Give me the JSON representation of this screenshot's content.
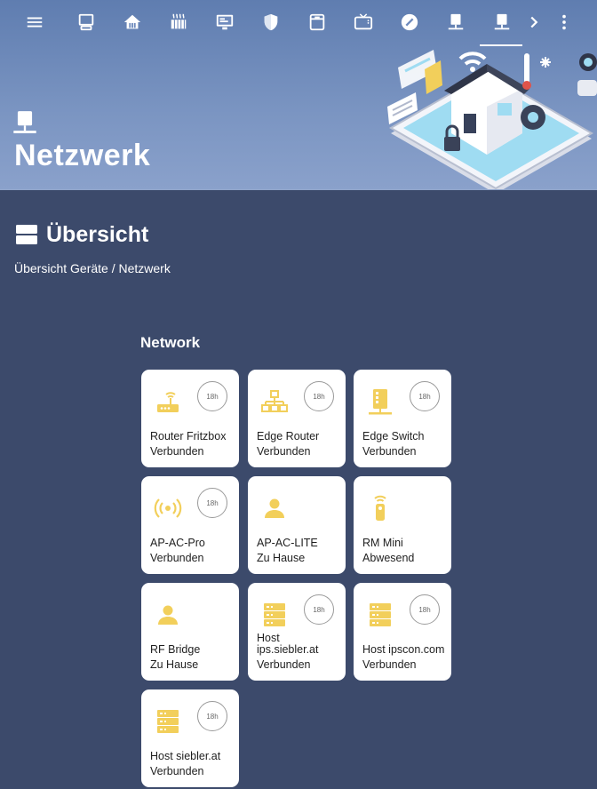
{
  "colors": {
    "background": "#3c4a6b",
    "header": "#6f8bbd",
    "accent": "#f2cf5b",
    "tile": "#ffffff"
  },
  "topbar": {
    "icons": [
      "menu-icon",
      "desktop-icon",
      "home-icon",
      "heater-icon",
      "monitor-icon",
      "shield-icon",
      "box-icon",
      "tv-icon",
      "speedometer-icon",
      "network-icon",
      "network-icon-active",
      "chevron-right-icon",
      "more-vert-icon"
    ]
  },
  "page": {
    "title": "Netzwerk",
    "icon": "network-icon"
  },
  "section": {
    "title": "Übersicht",
    "breadcrumb": "Übersicht Geräte / Netzwerk",
    "icon": "view-agenda-icon"
  },
  "group": {
    "title": "Network"
  },
  "tiles": [
    {
      "name": "Router Fritzbox",
      "status": "Verbunden",
      "badge": "18h",
      "icon": "router-icon"
    },
    {
      "name": "Edge Router",
      "status": "Verbunden",
      "badge": "18h",
      "icon": "lan-icon"
    },
    {
      "name": "Edge Switch",
      "status": "Verbunden",
      "badge": "18h",
      "icon": "switch-icon"
    },
    {
      "name": "AP-AC-Pro",
      "status": "Verbunden",
      "badge": "18h",
      "icon": "access-point-icon"
    },
    {
      "name": "AP-AC-LITE",
      "status": "Zu Hause",
      "badge": "",
      "icon": "person-icon"
    },
    {
      "name": "RM Mini",
      "status": "Abwesend",
      "badge": "",
      "icon": "remote-icon"
    },
    {
      "name": "RF Bridge",
      "status": "Zu Hause",
      "badge": "",
      "icon": "person-icon"
    },
    {
      "name": "Host ips.siebler.at",
      "status": "Verbunden",
      "badge": "18h",
      "icon": "server-icon"
    },
    {
      "name": "Host ipscon.com",
      "status": "Verbunden",
      "badge": "18h",
      "icon": "server-icon"
    },
    {
      "name": "Host siebler.at",
      "status": "Verbunden",
      "badge": "18h",
      "icon": "server-icon"
    }
  ]
}
